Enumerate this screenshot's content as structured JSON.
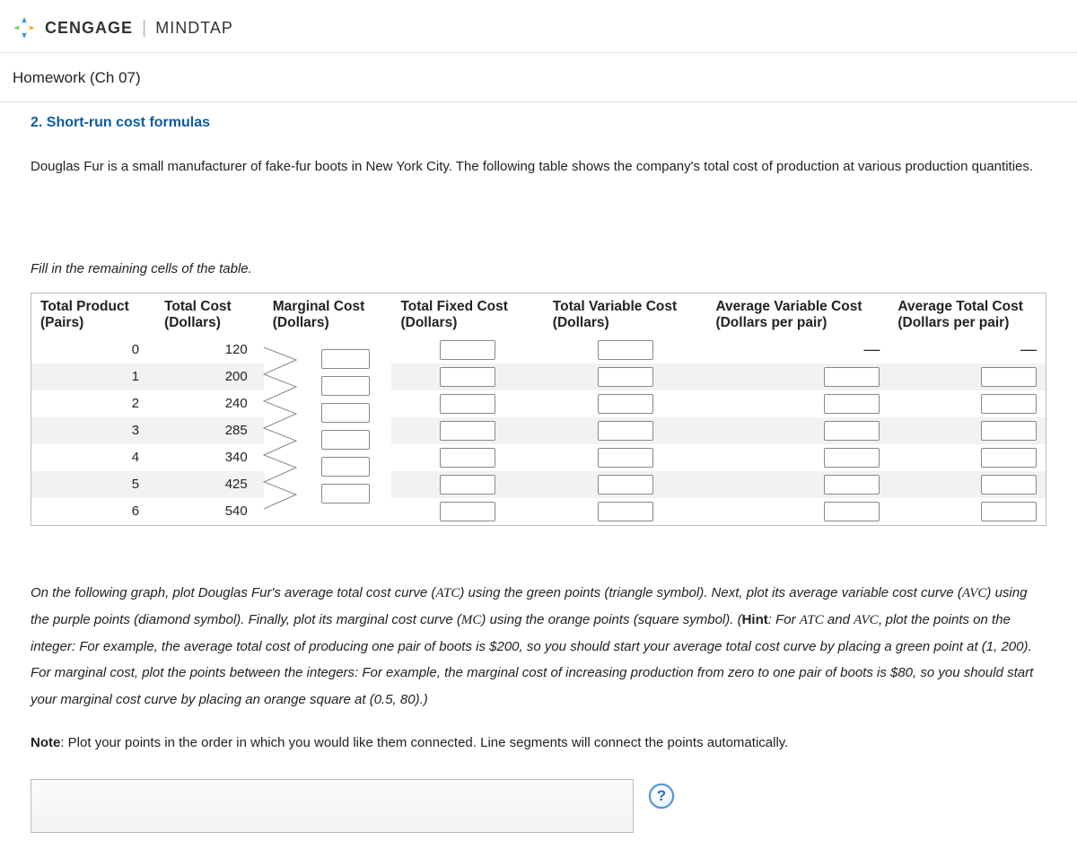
{
  "brand": {
    "cengage": "CENGAGE",
    "mindtap": "MINDTAP"
  },
  "assignment_title": "Homework (Ch 07)",
  "question_title": "2. Short-run cost formulas",
  "intro_text": "Douglas Fur is a small manufacturer of fake-fur boots in New York City. The following table shows the company's total cost of production at various production quantities.",
  "fill_instruction": "Fill in the remaining cells of the table.",
  "columns": {
    "tp": {
      "top": "Total Product",
      "sub": "(Pairs)"
    },
    "tc": {
      "top": "Total Cost",
      "sub": "(Dollars)"
    },
    "mc": {
      "top": "Marginal Cost",
      "sub": "(Dollars)"
    },
    "tfc": {
      "top": "Total Fixed Cost",
      "sub": "(Dollars)"
    },
    "tvc": {
      "top": "Total Variable Cost",
      "sub": "(Dollars)"
    },
    "avc": {
      "top": "Average Variable Cost",
      "sub": "(Dollars per pair)"
    },
    "atc": {
      "top": "Average Total Cost",
      "sub": "(Dollars per pair)"
    }
  },
  "rows": [
    {
      "tp": "0",
      "tc": "120"
    },
    {
      "tp": "1",
      "tc": "200"
    },
    {
      "tp": "2",
      "tc": "240"
    },
    {
      "tp": "3",
      "tc": "285"
    },
    {
      "tp": "4",
      "tc": "340"
    },
    {
      "tp": "5",
      "tc": "425"
    },
    {
      "tp": "6",
      "tc": "540"
    }
  ],
  "dash": "—",
  "graph_instructions": {
    "p1a": "On the following graph, plot Douglas Fur's average total cost curve (",
    "atc": "ATC",
    "p1b": ") using the green points (triangle symbol). Next, plot its average variable cost curve (",
    "avc": "AVC",
    "p1c": ") using the purple points (diamond symbol). Finally, plot its marginal cost curve (",
    "mc": "MC",
    "p1d": ") using the orange points (square symbol). (",
    "hint_label": "Hint",
    "p1e": ": For ",
    "atc2": "ATC",
    "and": " and ",
    "avc2": "AVC,",
    "p1f": " plot the points on the integer: For example, the average total cost of producing one pair of boots is $200, so you should start your average total cost curve by placing a green point at (1, 200). For marginal cost, plot the points between the integers: For example, the marginal cost of increasing production from zero to one pair of boots is $80, so you should start your marginal cost curve by placing an orange square at (0.5, 80).)"
  },
  "note": {
    "label": "Note",
    "text": ": Plot your points in the order in which you would like them connected. Line segments will connect the points automatically."
  },
  "help_symbol": "?"
}
